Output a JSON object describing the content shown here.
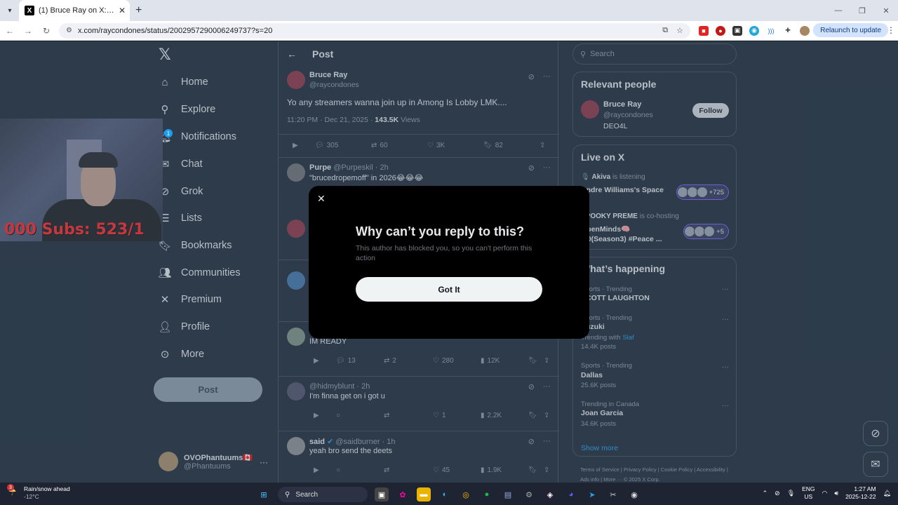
{
  "browser": {
    "tab_title": "(1) Bruce Ray on X: \"Yo any stre",
    "url": "x.com/raycondones/status/2002957290006249737?s=20",
    "relaunch_label": "Relaunch to update"
  },
  "nav": {
    "items": [
      {
        "label": "Home",
        "icon": "home-icon"
      },
      {
        "label": "Explore",
        "icon": "search-icon"
      },
      {
        "label": "Notifications",
        "icon": "bell-icon"
      },
      {
        "label": "Chat",
        "icon": "chat-icon"
      },
      {
        "label": "Grok",
        "icon": "grok-icon"
      },
      {
        "label": "Lists",
        "icon": "list-icon"
      },
      {
        "label": "Bookmarks",
        "icon": "bookmark-icon"
      },
      {
        "label": "Communities",
        "icon": "people-icon"
      },
      {
        "label": "Premium",
        "icon": "x-icon"
      },
      {
        "label": "Profile",
        "icon": "person-icon"
      },
      {
        "label": "More",
        "icon": "more-circle-icon"
      }
    ],
    "notification_count": "1",
    "post_label": "Post",
    "account_name": "OVOPhantuums🇨🇦",
    "account_handle": "@Phantuums"
  },
  "webcam": {
    "overlay_text": "000  Subs: 523/1"
  },
  "header": {
    "title": "Post"
  },
  "main_post": {
    "name": "Bruce Ray",
    "handle": "@raycondones",
    "text": "Yo any streamers wanna join up in Among Is Lobby LMK....",
    "time": "11:20 PM · Dec 21, 2025 · ",
    "views_count": "143.5K",
    "views_label": " Views",
    "replies": "305",
    "reposts": "60",
    "likes": "3K",
    "bookmarks": "82"
  },
  "replies": [
    {
      "name": "Purpe",
      "handle": "@Purpeskil",
      "time": "· 2h",
      "text": "\"brucedropemoff\" in 2026😂😂😂"
    },
    {
      "name": "",
      "handle": "",
      "time": "",
      "text": "IM READY",
      "replies": "13",
      "reposts": "2",
      "likes": "280",
      "views": "12K"
    },
    {
      "name": "",
      "handle": "@hidmyblunt",
      "time": "· 2h",
      "text": "I'm finna get on i got u",
      "likes": "1",
      "views": "2.2K"
    },
    {
      "name": "said",
      "handle": "@saidburner",
      "time": "· 1h",
      "text": "yeah bro send the deets",
      "likes": "45",
      "views": "1.9K"
    }
  ],
  "modal": {
    "title": "Why can’t you reply to this?",
    "body": "This author has blocked you, so you can't perform this action",
    "button": "Got It"
  },
  "right": {
    "search_placeholder": "Search",
    "relevant_title": "Relevant people",
    "relevant_name": "Bruce Ray",
    "relevant_handle": "@raycondones",
    "relevant_bio": "DEO4L",
    "follow_label": "Follow",
    "live_title": "Live on X",
    "live": [
      {
        "host": "Akiva",
        "status": " is listening",
        "title": "Andre Williams's Space",
        "count": "+725"
      },
      {
        "host": "SPOOKY PREME",
        "status": " is co-hosting",
        "title": "OpenMinds🧠 .50(Season3) #Peace ...",
        "count": "+5"
      }
    ],
    "happening_title": "What’s happening",
    "trends": [
      {
        "category": "Sports · Trending",
        "name": "SCOTT LAUGHTON",
        "sub": ""
      },
      {
        "category": "Sports · Trending",
        "name": "Suzuki",
        "sub_prefix": "Trending with ",
        "sub_link": "Slaf",
        "posts": "14.4K posts"
      },
      {
        "category": "Sports · Trending",
        "name": "Dallas",
        "posts": "25.6K posts"
      },
      {
        "category": "Trending in Canada",
        "name": "Joan Garcia",
        "posts": "34.6K posts"
      }
    ],
    "show_more": "Show more",
    "footer": "Terms of Service  |  Privacy Policy  |  Cookie Policy  |  Accessibility  |  Ads info  |  More ···  © 2025 X Corp."
  },
  "taskbar": {
    "weather_title": "Rain/snow ahead",
    "weather_temp": "-12°C",
    "weather_badge": "3",
    "search_label": "Search",
    "lang_top": "ENG",
    "lang_bottom": "US",
    "time": "1:27 AM",
    "date": "2025-12-22"
  }
}
